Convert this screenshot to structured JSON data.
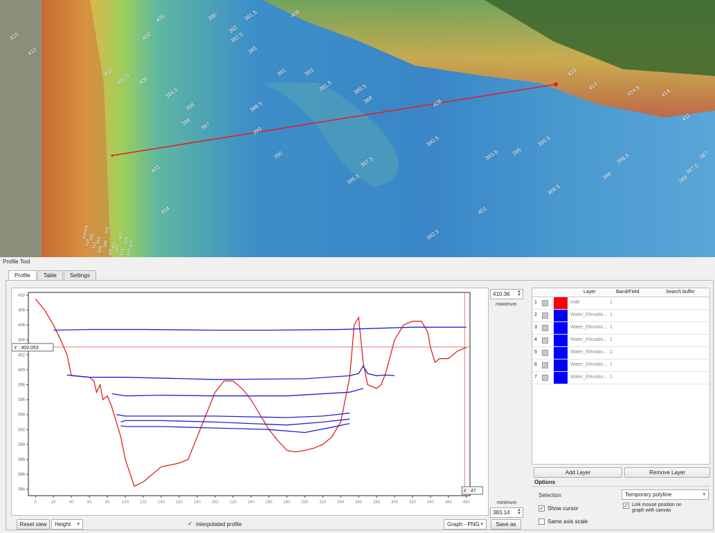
{
  "map": {
    "contour_labels": [
      "415",
      "410",
      "400",
      "395",
      "392",
      "381.5",
      "382.5",
      "385",
      "388",
      "390",
      "391",
      "386.5",
      "402",
      "400",
      "405",
      "402.5",
      "394.5",
      "398",
      "396",
      "397",
      "403",
      "404",
      "409",
      "410",
      "413",
      "414.5",
      "414",
      "411",
      "390.5",
      "393",
      "393.5",
      "395",
      "399.5",
      "396.5",
      "387",
      "387.5",
      "388",
      "388.5",
      "389",
      "389.5",
      "391.5",
      "392.5",
      "395.5",
      "397.5",
      "401",
      "399",
      "408"
    ],
    "contour_numbers": [
      392,
      393,
      399,
      400,
      401,
      402,
      404,
      406,
      407,
      408,
      409,
      410,
      412,
      413,
      414,
      419,
      420
    ],
    "profile_line": {
      "color": "#e0202a"
    }
  },
  "panel": {
    "title": "Profile Tool",
    "tabs": [
      {
        "label": "Profile",
        "active": true
      },
      {
        "label": "Table",
        "active": false
      },
      {
        "label": "Settings",
        "active": false
      }
    ]
  },
  "graph": {
    "cursor_y_label": "Y : 403.053",
    "cursor_x_label": "X : 47",
    "max_value": "410.36",
    "max_label": "maximum",
    "min_value": "383.14",
    "min_label": "minimum",
    "colors": {
      "profile": "#e02020",
      "water": "#2020d0",
      "cursor": "#e06060"
    }
  },
  "chart_data": {
    "type": "line",
    "xlim": [
      -8,
      484
    ],
    "ylim": [
      383.14,
      410.36
    ],
    "xticks": [
      0,
      20,
      40,
      60,
      80,
      100,
      120,
      140,
      160,
      180,
      200,
      220,
      240,
      260,
      280,
      300,
      320,
      340,
      360,
      380,
      400,
      420,
      440,
      460,
      480
    ],
    "yticks": [
      384,
      386,
      388,
      390,
      392,
      394,
      396,
      398,
      400,
      402,
      404,
      406,
      408,
      410
    ],
    "cursor": {
      "x": 478,
      "y": 403.053
    },
    "series": [
      {
        "name": "mde",
        "color": "#e02020",
        "x": [
          0,
          10,
          20,
          28,
          35,
          40,
          60,
          65,
          68,
          72,
          75,
          80,
          85,
          90,
          95,
          100,
          110,
          120,
          140,
          160,
          170,
          180,
          190,
          200,
          210,
          220,
          230,
          240,
          250,
          260,
          270,
          280,
          290,
          300,
          310,
          320,
          330,
          340,
          350,
          355,
          360,
          365,
          370,
          380,
          385,
          390,
          400,
          410,
          420,
          430,
          437,
          440,
          445,
          450,
          460,
          470,
          480
        ],
        "y": [
          409.5,
          408,
          406,
          404,
          402,
          399.2,
          399,
          398.5,
          397,
          398,
          396,
          396.5,
          395,
          393,
          391,
          388,
          384.4,
          385,
          387,
          387.5,
          388,
          391,
          394,
          397,
          398.5,
          398.5,
          397.5,
          396,
          394,
          392,
          390.5,
          389.2,
          389,
          389.2,
          389.5,
          390,
          391,
          393,
          399,
          406,
          407,
          401,
          398,
          397.5,
          398,
          399.5,
          404,
          406,
          406.5,
          406.5,
          405,
          403,
          401,
          401.5,
          401.5,
          402.5,
          403
        ]
      },
      {
        "name": "Water_Elevatio...",
        "color": "#2020d0",
        "x": [
          20,
          60,
          120,
          200,
          260,
          340,
          420,
          480
        ],
        "y": [
          405.3,
          405.4,
          405.4,
          405.3,
          405.3,
          405.4,
          405.7,
          405.7
        ]
      },
      {
        "name": "Water_Elevatio...",
        "color": "#2020d0",
        "x": [
          35,
          60,
          100,
          200,
          300,
          350,
          360,
          365,
          370,
          380,
          390,
          400
        ],
        "y": [
          399.3,
          399,
          399,
          398.7,
          398.8,
          399.2,
          399.5,
          400.5,
          399.5,
          399.2,
          399.3,
          399.2
        ]
      },
      {
        "name": "Water_Elevatio...",
        "color": "#2020d0",
        "x": [
          85,
          100,
          140,
          200,
          280,
          350,
          365
        ],
        "y": [
          396.8,
          396.5,
          396.6,
          396.5,
          396.5,
          397,
          397.5
        ]
      },
      {
        "name": "Water_Elevatio...",
        "color": "#2020d0",
        "x": [
          90,
          100,
          140,
          200,
          280,
          320,
          350
        ],
        "y": [
          394,
          393.8,
          393.8,
          393.8,
          393.6,
          393.8,
          394.2
        ]
      },
      {
        "name": "Water_Elevatio...",
        "color": "#2020d0",
        "x": [
          95,
          100,
          140,
          200,
          280,
          320,
          350
        ],
        "y": [
          393,
          393.2,
          393.2,
          393,
          392.6,
          393,
          393.4
        ]
      },
      {
        "name": "Water_Elevatio...",
        "color": "#2020d0",
        "x": [
          95,
          100,
          140,
          200,
          260,
          300,
          330,
          350
        ],
        "y": [
          392.5,
          392.4,
          392.4,
          392.2,
          392,
          391.6,
          392.3,
          392.8
        ]
      }
    ]
  },
  "bottom_bar": {
    "reset_view": "Reset view",
    "height_combo": "Height",
    "interpolated_label": "Interpolated profile",
    "interpolated_checked": "✓",
    "format_combo": "Graph - PNG",
    "save_as": "Save as"
  },
  "layers": {
    "headers": {
      "layer": "Layer",
      "band": "Band/Field",
      "buffer": "Search buffer"
    },
    "rows": [
      {
        "num": "1",
        "name": "mde",
        "band": "1",
        "color": "#ff0000"
      },
      {
        "num": "2",
        "name": "Water_Elevatio...",
        "band": "1",
        "color": "#0000ff"
      },
      {
        "num": "3",
        "name": "Water_Elevatio...",
        "band": "1",
        "color": "#0000ff"
      },
      {
        "num": "4",
        "name": "Water_Elevatio...",
        "band": "1",
        "color": "#0000ff"
      },
      {
        "num": "5",
        "name": "Water_Elevatio...",
        "band": "1",
        "color": "#0000ff"
      },
      {
        "num": "6",
        "name": "Water_Elevatio...",
        "band": "1",
        "color": "#0000ff"
      },
      {
        "num": "7",
        "name": "Water_Elevatio...",
        "band": "1",
        "color": "#0000ff"
      }
    ],
    "add_layer": "Add Layer",
    "remove_layer": "Remove Layer"
  },
  "options": {
    "title": "Options",
    "selection_label": "Selection",
    "selection_value": "Temporary polyline",
    "show_cursor": "Show cursor",
    "show_cursor_checked": "✓",
    "link_mouse": "Link mouse position on graph with canvas",
    "link_mouse_checked": "✓",
    "same_axis": "Same axis scale"
  }
}
